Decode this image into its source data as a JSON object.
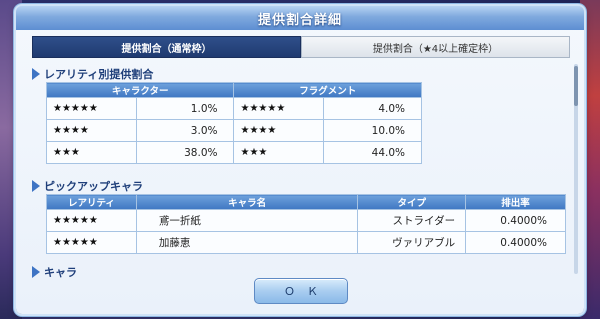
{
  "dialog": {
    "title": "提供割合詳細"
  },
  "tabs": [
    {
      "label": "提供割合（通常枠）",
      "active": true
    },
    {
      "label": "提供割合（★4以上確定枠）",
      "active": false
    }
  ],
  "rarity_section": {
    "title": "レアリティ別提供割合",
    "headers": [
      "キャラクター",
      "フラグメント"
    ],
    "rows": [
      {
        "char_stars": "★★★★★",
        "char_rate": "1.0%",
        "frag_stars": "★★★★★",
        "frag_rate": "4.0%"
      },
      {
        "char_stars": "★★★★",
        "char_rate": "3.0%",
        "frag_stars": "★★★★",
        "frag_rate": "10.0%"
      },
      {
        "char_stars": "★★★",
        "char_rate": "38.0%",
        "frag_stars": "★★★",
        "frag_rate": "44.0%"
      }
    ]
  },
  "pickup_section": {
    "title": "ピックアップキャラ",
    "headers": [
      "レアリティ",
      "キャラ名",
      "タイプ",
      "排出率"
    ],
    "rows": [
      {
        "rarity": "★★★★★",
        "name": "鳶一折紙",
        "type": "ストライダー",
        "rate": "0.4000%"
      },
      {
        "rarity": "★★★★★",
        "name": "加藤恵",
        "type": "ヴァリアブル",
        "rate": "0.4000%"
      }
    ]
  },
  "chara_section": {
    "title": "キャラ"
  },
  "ok_label": "ＯＫ",
  "colors": {
    "header_blue": "#3f77c2",
    "tab_active": "#1f3a70",
    "title_bar": "#7fa9de"
  }
}
